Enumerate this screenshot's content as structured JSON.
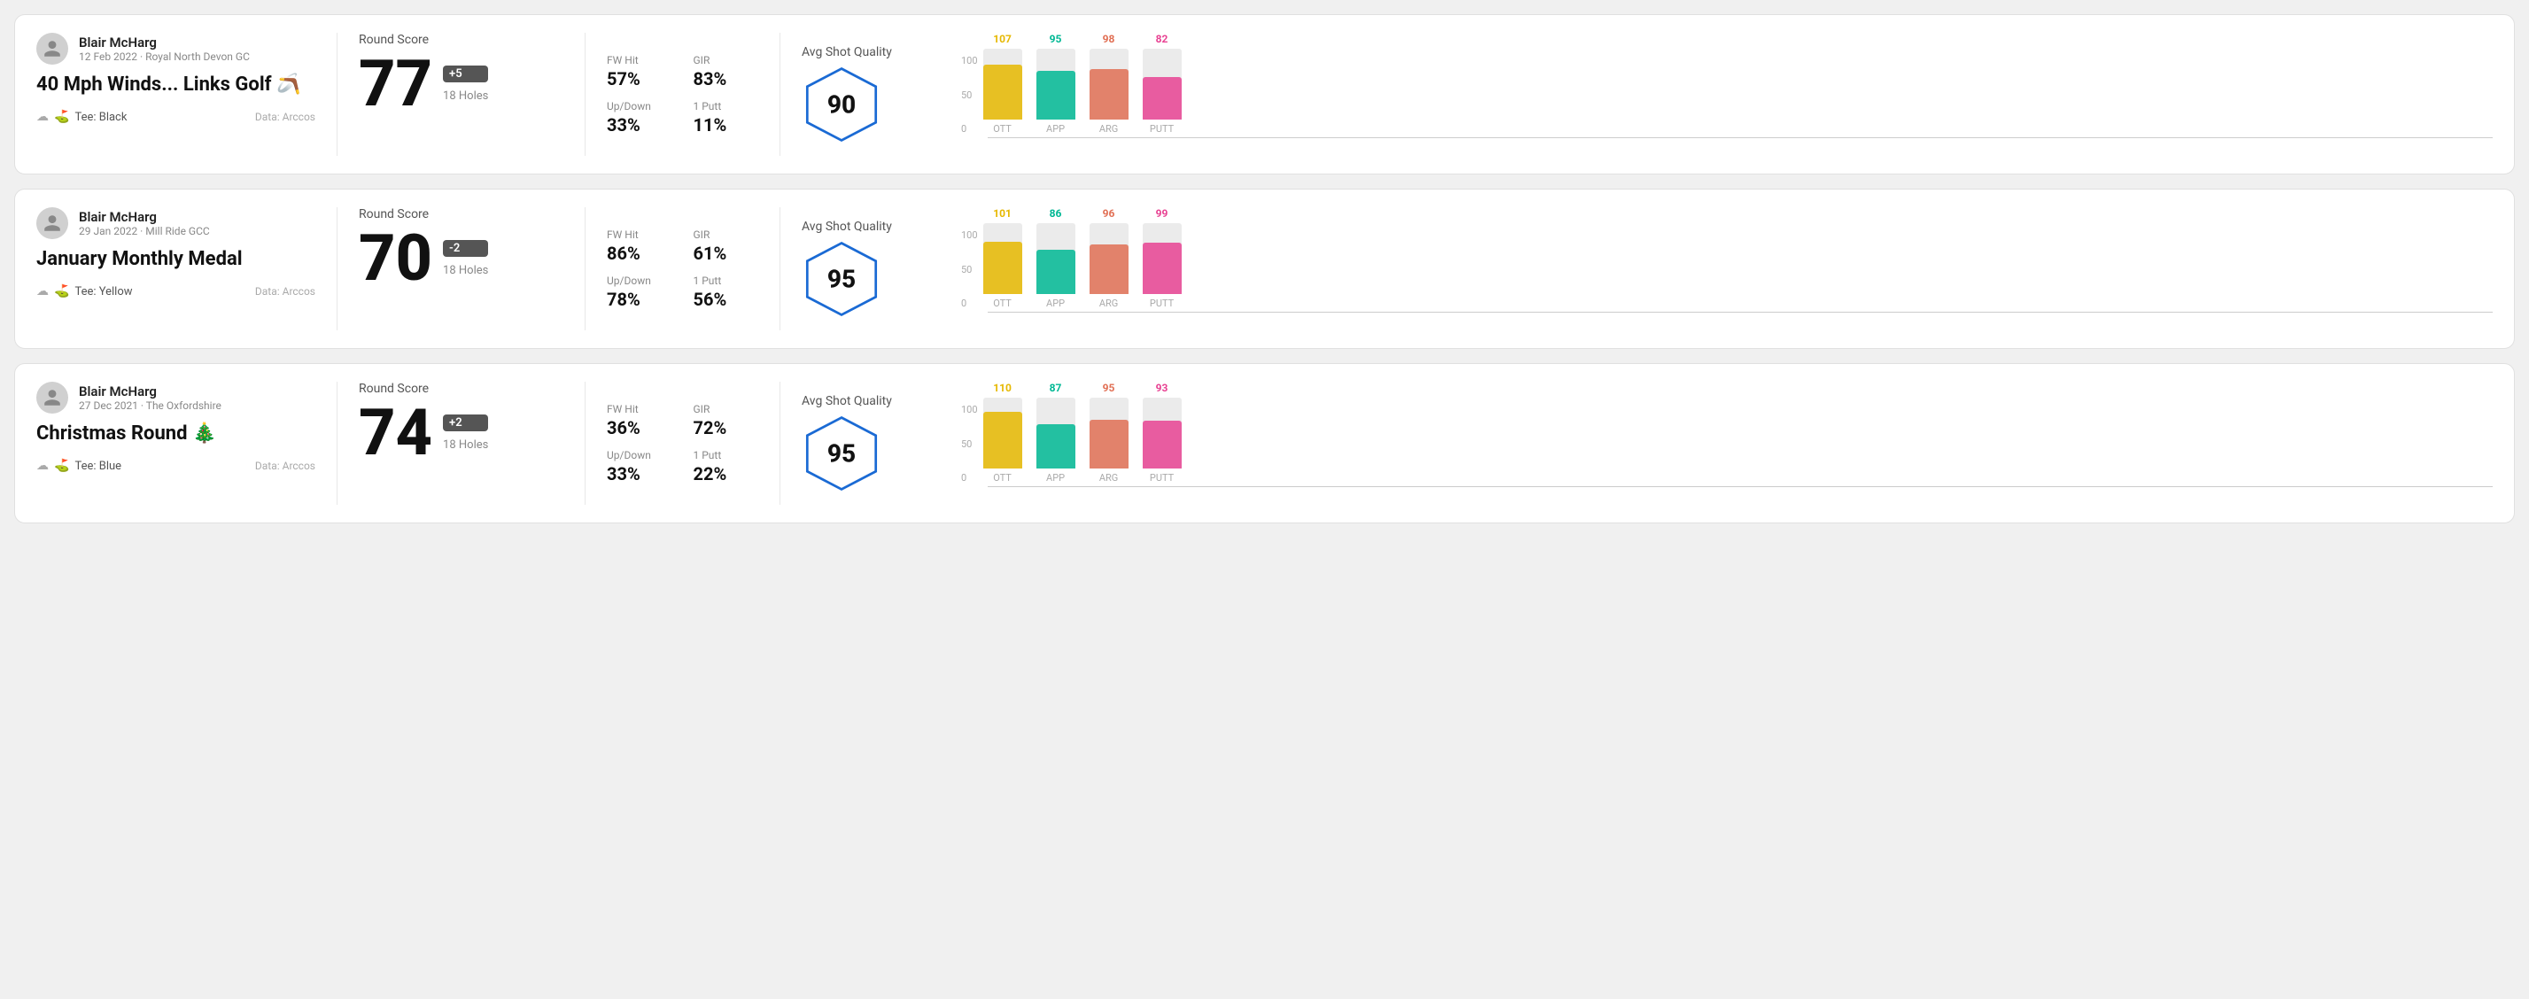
{
  "rounds": [
    {
      "player_name": "Blair McHarg",
      "player_meta": "12 Feb 2022 · Royal North Devon GC",
      "round_title": "40 Mph Winds... Links Golf 🪃",
      "tee": "Black",
      "data_source": "Data: Arccos",
      "round_score_label": "Round Score",
      "score": "77",
      "score_badge": "+5",
      "holes": "18 Holes",
      "fw_hit_label": "FW Hit",
      "fw_hit_value": "57%",
      "gir_label": "GIR",
      "gir_value": "83%",
      "updown_label": "Up/Down",
      "updown_value": "33%",
      "oneputt_label": "1 Putt",
      "oneputt_value": "11%",
      "avg_shot_quality_label": "Avg Shot Quality",
      "quality_score": "90",
      "chart": {
        "bars": [
          {
            "label": "OTT",
            "value": 107,
            "color": "#e6b800",
            "height_pct": 78
          },
          {
            "label": "APP",
            "value": 95,
            "color": "#00b894",
            "height_pct": 69
          },
          {
            "label": "ARG",
            "value": 98,
            "color": "#e17055",
            "height_pct": 71
          },
          {
            "label": "PUTT",
            "value": 82,
            "color": "#e84393",
            "height_pct": 60
          }
        ]
      }
    },
    {
      "player_name": "Blair McHarg",
      "player_meta": "29 Jan 2022 · Mill Ride GCC",
      "round_title": "January Monthly Medal",
      "tee": "Yellow",
      "data_source": "Data: Arccos",
      "round_score_label": "Round Score",
      "score": "70",
      "score_badge": "-2",
      "holes": "18 Holes",
      "fw_hit_label": "FW Hit",
      "fw_hit_value": "86%",
      "gir_label": "GIR",
      "gir_value": "61%",
      "updown_label": "Up/Down",
      "updown_value": "78%",
      "oneputt_label": "1 Putt",
      "oneputt_value": "56%",
      "avg_shot_quality_label": "Avg Shot Quality",
      "quality_score": "95",
      "chart": {
        "bars": [
          {
            "label": "OTT",
            "value": 101,
            "color": "#e6b800",
            "height_pct": 74
          },
          {
            "label": "APP",
            "value": 86,
            "color": "#00b894",
            "height_pct": 63
          },
          {
            "label": "ARG",
            "value": 96,
            "color": "#e17055",
            "height_pct": 70
          },
          {
            "label": "PUTT",
            "value": 99,
            "color": "#e84393",
            "height_pct": 72
          }
        ]
      }
    },
    {
      "player_name": "Blair McHarg",
      "player_meta": "27 Dec 2021 · The Oxfordshire",
      "round_title": "Christmas Round 🎄",
      "tee": "Blue",
      "data_source": "Data: Arccos",
      "round_score_label": "Round Score",
      "score": "74",
      "score_badge": "+2",
      "holes": "18 Holes",
      "fw_hit_label": "FW Hit",
      "fw_hit_value": "36%",
      "gir_label": "GIR",
      "gir_value": "72%",
      "updown_label": "Up/Down",
      "updown_value": "33%",
      "oneputt_label": "1 Putt",
      "oneputt_value": "22%",
      "avg_shot_quality_label": "Avg Shot Quality",
      "quality_score": "95",
      "chart": {
        "bars": [
          {
            "label": "OTT",
            "value": 110,
            "color": "#e6b800",
            "height_pct": 80
          },
          {
            "label": "APP",
            "value": 87,
            "color": "#00b894",
            "height_pct": 63
          },
          {
            "label": "ARG",
            "value": 95,
            "color": "#e17055",
            "height_pct": 69
          },
          {
            "label": "PUTT",
            "value": 93,
            "color": "#e84393",
            "height_pct": 68
          }
        ]
      }
    }
  ],
  "chart_y_labels": [
    "100",
    "50",
    "0"
  ]
}
